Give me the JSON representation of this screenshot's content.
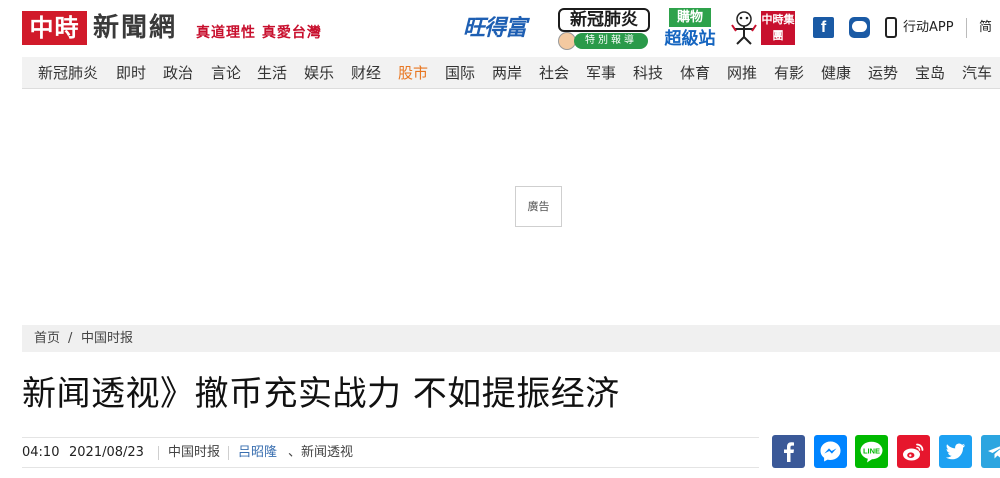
{
  "header": {
    "logo_mark": "中時",
    "logo_text": "新聞網",
    "slogan": "真道理性 真愛台灣",
    "partner_want": "旺得富",
    "covid_badge_title": "新冠肺炎",
    "covid_badge_sub": "特別報導",
    "shop_top": "購物",
    "shop_bottom": "超級站",
    "group_logo": "中時集團",
    "facebook_label": "f",
    "app_label": "行动APP",
    "lang_label": "简"
  },
  "nav": {
    "items": [
      {
        "label": "新冠肺炎",
        "active": false
      },
      {
        "label": "即时",
        "active": false
      },
      {
        "label": "政治",
        "active": false
      },
      {
        "label": "言论",
        "active": false
      },
      {
        "label": "生活",
        "active": false
      },
      {
        "label": "娱乐",
        "active": false
      },
      {
        "label": "财经",
        "active": false
      },
      {
        "label": "股市",
        "active": true
      },
      {
        "label": "国际",
        "active": false
      },
      {
        "label": "两岸",
        "active": false
      },
      {
        "label": "社会",
        "active": false
      },
      {
        "label": "军事",
        "active": false
      },
      {
        "label": "科技",
        "active": false
      },
      {
        "label": "体育",
        "active": false
      },
      {
        "label": "网推",
        "active": false
      },
      {
        "label": "有影",
        "active": false
      },
      {
        "label": "健康",
        "active": false
      },
      {
        "label": "运势",
        "active": false
      },
      {
        "label": "宝岛",
        "active": false
      },
      {
        "label": "汽车",
        "active": false
      }
    ],
    "active_color": "#e87722"
  },
  "ad": {
    "label": "廣告"
  },
  "breadcrumb": {
    "home": "首页",
    "separator": "/",
    "section": "中国时报"
  },
  "article": {
    "title": "新闻透视》撤币充实战力 不如提振经济",
    "time": "04:10",
    "date": "2021/08/23",
    "source": "中国时报",
    "author": "吕昭隆",
    "topic": "、新闻透视"
  },
  "share": {
    "buttons": [
      {
        "name": "facebook",
        "color": "#3b5998"
      },
      {
        "name": "messenger",
        "color": "#0084ff"
      },
      {
        "name": "line",
        "color": "#00b900"
      },
      {
        "name": "weibo",
        "color": "#e6162d"
      },
      {
        "name": "twitter",
        "color": "#1da1f2"
      },
      {
        "name": "telegram",
        "color": "#2ca5e0"
      }
    ]
  },
  "colors": {
    "brand_red": "#d11a2a",
    "nav_bg": "#f2f2f2",
    "link_blue": "#3a6fb0"
  }
}
